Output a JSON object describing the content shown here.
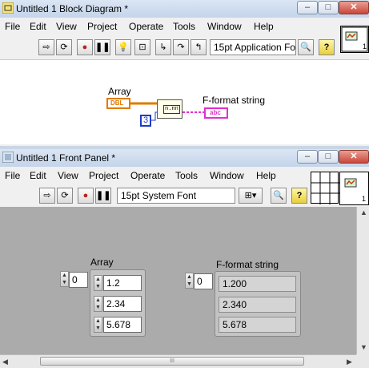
{
  "block_diagram": {
    "title": "Untitled 1 Block Diagram *",
    "menu": [
      "File",
      "Edit",
      "View",
      "Project",
      "Operate",
      "Tools",
      "Window",
      "Help"
    ],
    "font_combo": "15pt Application Fo",
    "array_label": "Array",
    "dbl_tag": "DBL",
    "constant_value": "3",
    "string_label": "F-format string",
    "abc_tag": "abc",
    "format_glyph": "n.nn"
  },
  "front_panel": {
    "title": "Untitled 1 Front Panel *",
    "menu": [
      "File",
      "Edit",
      "View",
      "Project",
      "Operate",
      "Tools",
      "Window",
      "Help"
    ],
    "font_combo": "15pt System Font",
    "array": {
      "label": "Array",
      "index": "0",
      "values": [
        "1.2",
        "2.34",
        "5.678"
      ]
    },
    "string_array": {
      "label": "F-format string",
      "index": "0",
      "values": [
        "1.200",
        "2.340",
        "5.678"
      ]
    }
  },
  "window_buttons": {
    "minimize": "–",
    "maximize": "□",
    "close": "✕"
  },
  "scrollbar_grip": "III",
  "connector_number": "1",
  "colors": {
    "dbl_orange": "#e07b00",
    "string_pink": "#e030d0",
    "int_blue": "#1e3cc8",
    "panel_gray": "#ababab",
    "help_yellow": "#f4dc40"
  }
}
